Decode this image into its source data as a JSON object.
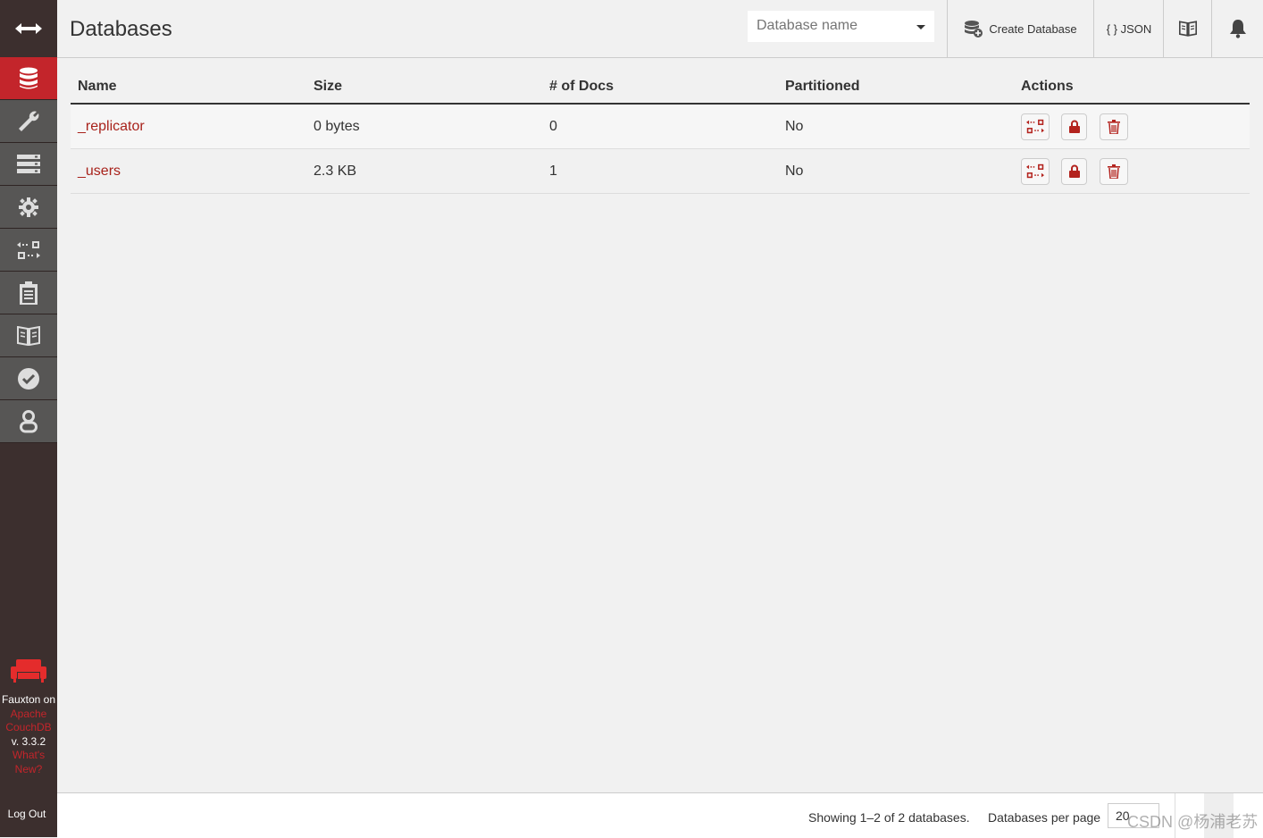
{
  "page_title": "Databases",
  "search": {
    "placeholder": "Database name"
  },
  "header_buttons": {
    "create_database": "Create Database",
    "json": "{ } JSON"
  },
  "sidebar": {
    "items": [
      {
        "name": "databases",
        "icon": "database-icon",
        "active": true
      },
      {
        "name": "setup",
        "icon": "wrench-icon"
      },
      {
        "name": "active-tasks",
        "icon": "server-icon"
      },
      {
        "name": "config",
        "icon": "gear-icon"
      },
      {
        "name": "replication",
        "icon": "replication-icon"
      },
      {
        "name": "logs",
        "icon": "clipboard-icon"
      },
      {
        "name": "documentation",
        "icon": "book-icon"
      },
      {
        "name": "verify",
        "icon": "check-circle-icon"
      },
      {
        "name": "user",
        "icon": "user-icon"
      }
    ],
    "brand": {
      "line1": "Fauxton on",
      "link1a": "Apache",
      "link1b": "CouchDB",
      "version": "v. 3.3.2",
      "link2a": "What's",
      "link2b": "New?"
    },
    "logout": "Log Out"
  },
  "table": {
    "headers": [
      "Name",
      "Size",
      "# of Docs",
      "Partitioned",
      "Actions"
    ],
    "rows": [
      {
        "name": "_replicator",
        "size": "0 bytes",
        "docs": "0",
        "partitioned": "No"
      },
      {
        "name": "_users",
        "size": "2.3 KB",
        "docs": "1",
        "partitioned": "No"
      }
    ]
  },
  "footer": {
    "showing": "Showing 1–2 of 2 databases.",
    "per_page_label": "Databases per page",
    "per_page_value": "20"
  },
  "watermark": "CSDN @杨浦老苏",
  "colors": {
    "accent": "#c3252b",
    "sidebar_bg": "#3c2f2e",
    "nav_item_bg": "#575655",
    "link": "#a8221b"
  }
}
